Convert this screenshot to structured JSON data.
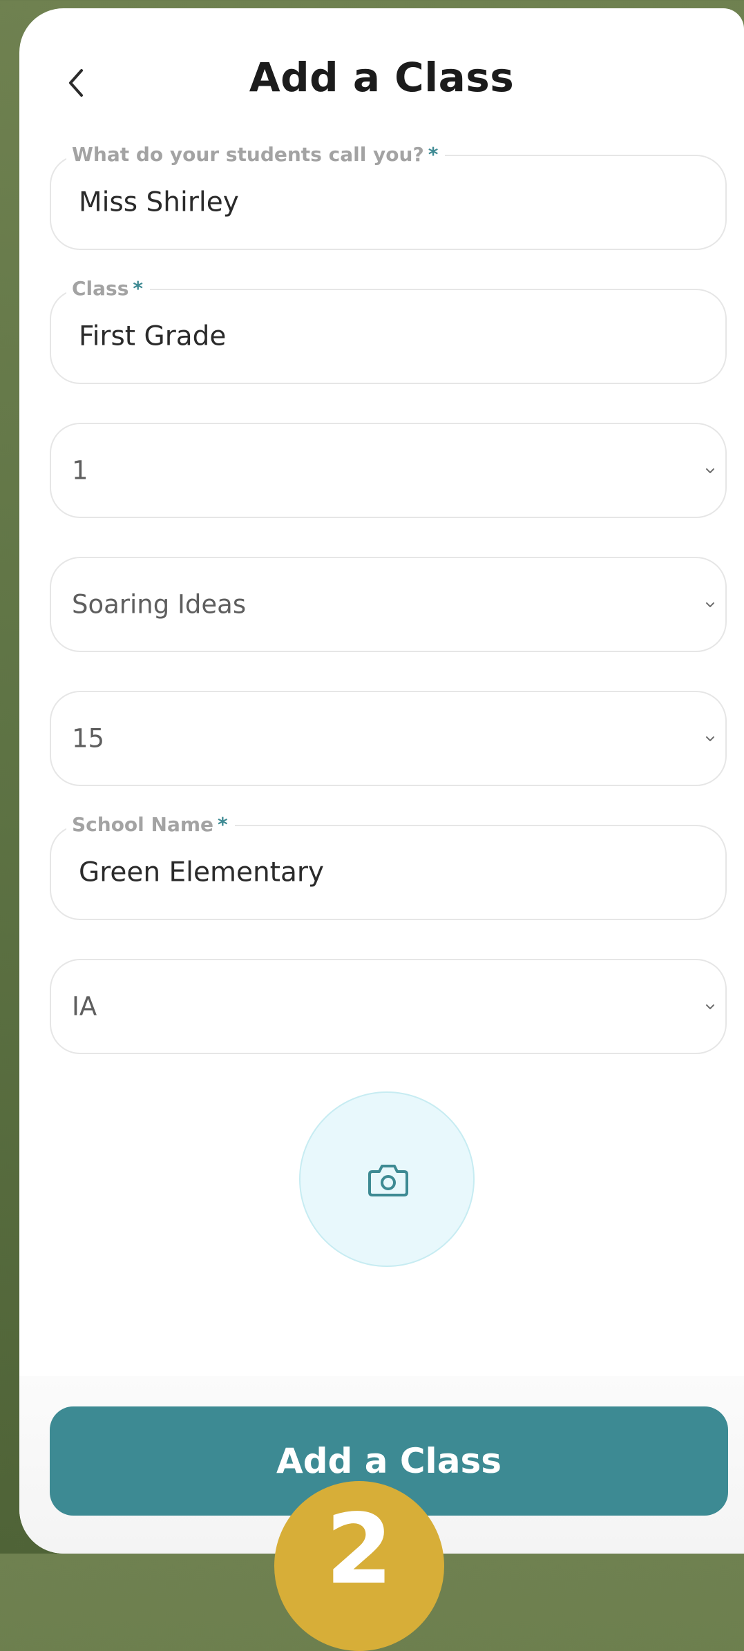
{
  "header": {
    "title": "Add a Class",
    "back_icon": "chevron-left-icon"
  },
  "form": {
    "teacher_name": {
      "label": "What do your students call you?",
      "required_mark": "*",
      "value": "Miss Shirley"
    },
    "class_name": {
      "label": "Class",
      "required_mark": "*",
      "value": "First Grade"
    },
    "grade_select": {
      "value": "1"
    },
    "curriculum_select": {
      "value": "Soaring Ideas"
    },
    "students_select": {
      "value": "15"
    },
    "school_name": {
      "label": "School Name",
      "required_mark": "*",
      "value": "Green Elementary"
    },
    "state_select": {
      "value": "IA"
    }
  },
  "photo_upload": {
    "icon": "camera-icon"
  },
  "footer": {
    "submit_label": "Add a Class"
  },
  "step_badge": {
    "label": "2"
  },
  "colors": {
    "background": "#5f7445",
    "accent": "#3d8a93",
    "badge": "#d7ae38",
    "photo_bg": "#e8f8fc"
  }
}
